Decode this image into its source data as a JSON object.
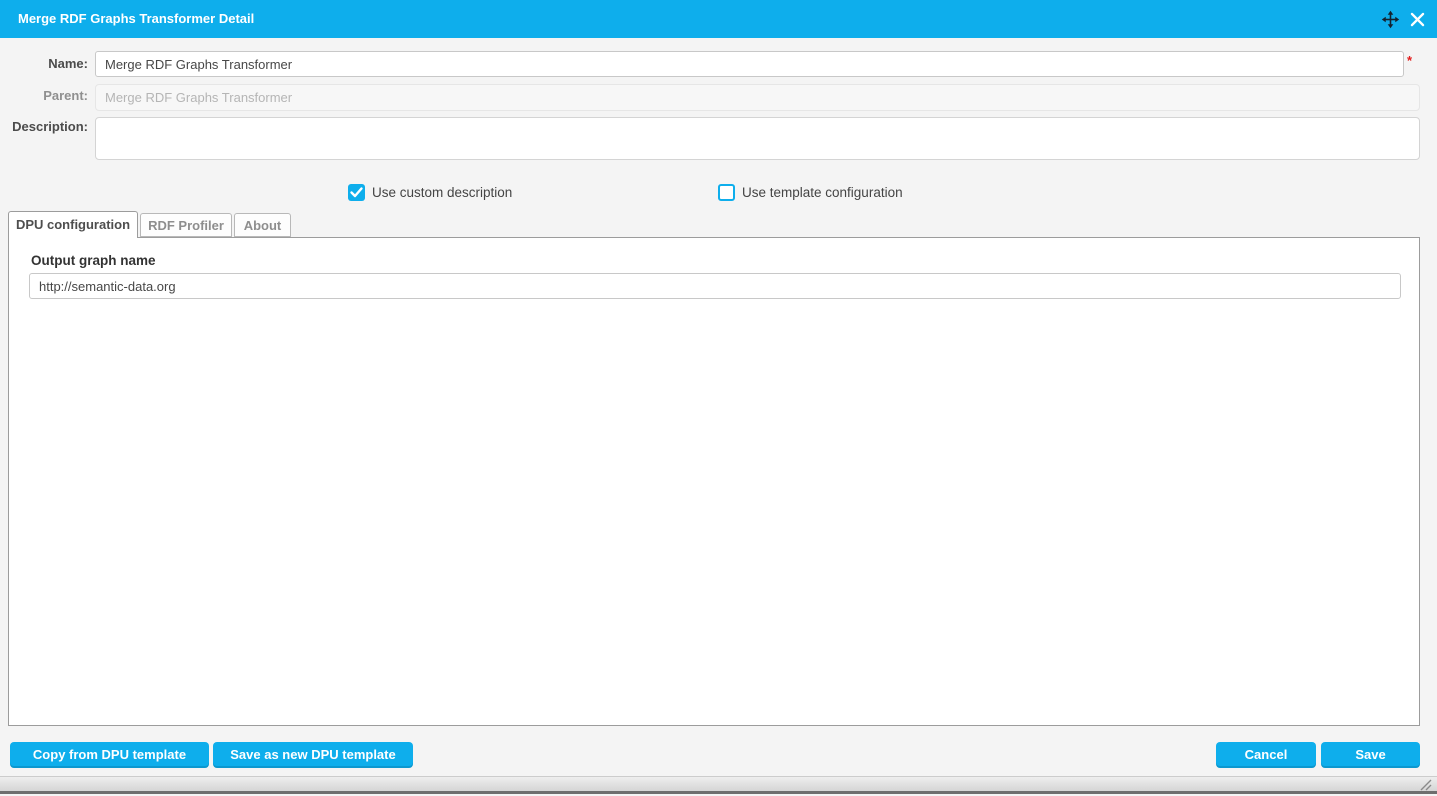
{
  "window": {
    "title": "Merge RDF Graphs Transformer Detail"
  },
  "form": {
    "name_label": "Name:",
    "name_value": "Merge RDF Graphs Transformer",
    "required_marker": "*",
    "parent_label": "Parent:",
    "parent_value": "Merge RDF Graphs Transformer",
    "description_label": "Description:",
    "description_value": "",
    "use_custom_description_label": "Use custom description",
    "use_custom_description_checked": true,
    "use_template_configuration_label": "Use template configuration",
    "use_template_configuration_checked": false
  },
  "tabs": [
    {
      "label": "DPU configuration",
      "active": true
    },
    {
      "label": "RDF Profiler",
      "active": false
    },
    {
      "label": "About",
      "active": false
    }
  ],
  "dpu_configuration": {
    "output_graph_name_label": "Output graph name",
    "output_graph_name_value": "http://semantic-data.org"
  },
  "footer": {
    "copy_from_template_label": "Copy from DPU template",
    "save_as_new_template_label": "Save as new DPU template",
    "cancel_label": "Cancel",
    "save_label": "Save"
  },
  "icons": {
    "move": "move-icon",
    "close": "close-icon",
    "resize": "resize-handle-icon",
    "checkmark": "checkmark-icon"
  },
  "colors": {
    "accent": "#0EAEEC",
    "required_asterisk": "#E31B1B",
    "dialog_background": "#F4F4F4",
    "panel_border": "#9C9C9C"
  }
}
